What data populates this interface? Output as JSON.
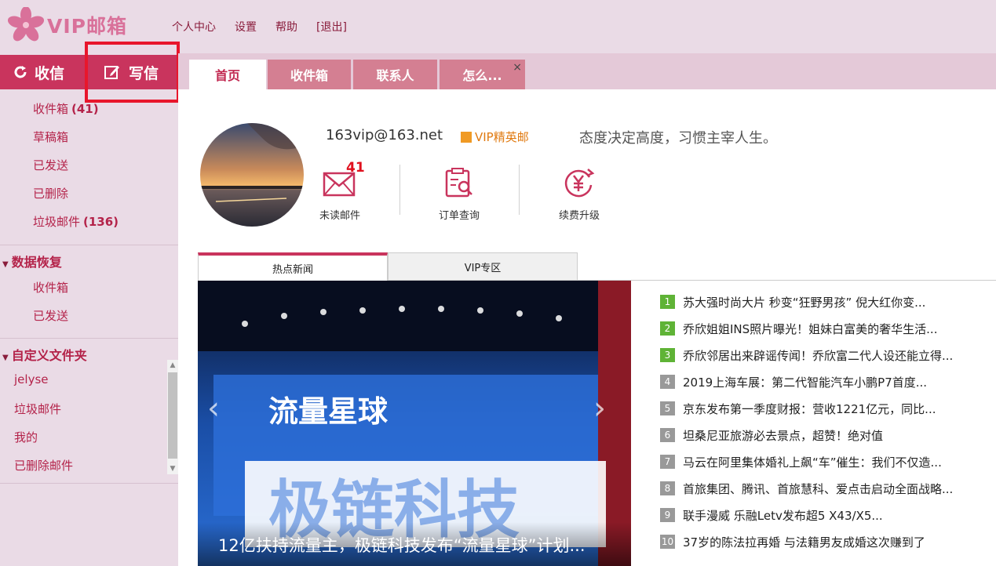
{
  "header": {
    "logo_text": "VIP邮箱",
    "links": [
      "个人中心",
      "设置",
      "帮助",
      "[退出]"
    ]
  },
  "sidebar": {
    "receive_label": "收信",
    "write_label": "写信",
    "folders": [
      {
        "label": "收件箱",
        "count": "(41)"
      },
      {
        "label": "草稿箱",
        "count": ""
      },
      {
        "label": "已发送",
        "count": ""
      },
      {
        "label": "已删除",
        "count": ""
      },
      {
        "label": "垃圾邮件",
        "count": "(136)"
      }
    ],
    "recovery_title": "数据恢复",
    "recovery_items": [
      "收件箱",
      "已发送"
    ],
    "custom_title": "自定义文件夹",
    "custom_items": [
      "jelyse",
      "垃圾邮件",
      "我的",
      "已删除邮件"
    ]
  },
  "tabs": [
    {
      "label": "首页",
      "active": true
    },
    {
      "label": "收件箱",
      "active": false
    },
    {
      "label": "联系人",
      "active": false
    },
    {
      "label": "怎么...",
      "active": false
    }
  ],
  "tab_close": "×",
  "profile": {
    "email": "163vip@163.net",
    "vip_label": "VIP精英邮",
    "motto": "态度决定高度，习惯主宰人生。"
  },
  "quick_actions": [
    {
      "label": "未读邮件",
      "icon": "envelope-icon",
      "badge": "41"
    },
    {
      "label": "订单查询",
      "icon": "order-search-icon",
      "badge": ""
    },
    {
      "label": "续费升级",
      "icon": "yen-renew-icon",
      "badge": ""
    }
  ],
  "news_tabs": [
    "热点新闻",
    "VIP专区"
  ],
  "banner_caption": "12亿扶持流量主，极链科技发布“流量星球”计划...",
  "news": [
    "苏大强时尚大片 秒变“狂野男孩” 倪大红你变...",
    "乔欣姐姐INS照片曝光！姐妹白富美的奢华生活...",
    "乔欣邻居出来辟谣传闻！乔欣富二代人设还能立得...",
    "2019上海车展：第二代智能汽车小鹏P7首度...",
    "京东发布第一季度财报：营收1221亿元，同比...",
    "坦桑尼亚旅游必去景点，超赞！绝对值",
    "马云在阿里集体婚礼上飙“车”催生：我们不仅造...",
    "首旅集团、腾讯、首旅慧科、爱点击启动全面战略...",
    "联手漫威 乐融Letv发布超5 X43/X5...",
    "37岁的陈法拉再婚 与法籍男友成婚这次赚到了"
  ],
  "news_numbers": [
    "1",
    "2",
    "3",
    "4",
    "5",
    "6",
    "7",
    "8",
    "9",
    "10"
  ],
  "colors": {
    "brand": "#c9345d",
    "accent_orange": "#e07a10",
    "rank_green": "#5fb336"
  }
}
